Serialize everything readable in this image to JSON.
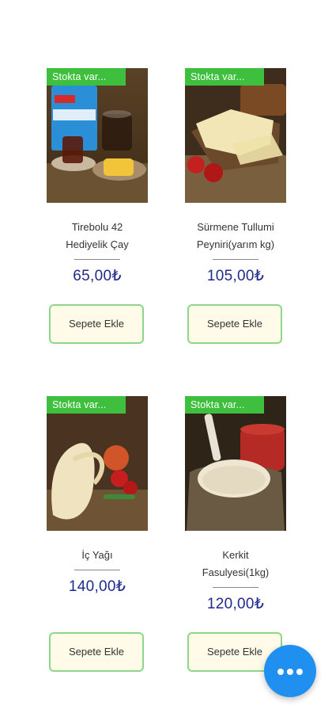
{
  "products": [
    {
      "badge": "Stokta var...",
      "title_line1": "Tirebolu 42",
      "title_line2": "Hediyelik Çay",
      "price": "65,00₺",
      "button": "Sepete Ekle"
    },
    {
      "badge": "Stokta var...",
      "title_line1": "Sürmene Tullumi",
      "title_line2": "Peyniri(yarım kg)",
      "price": "105,00₺",
      "button": "Sepete Ekle"
    },
    {
      "badge": "Stokta var...",
      "title_line1": "İç Yağı",
      "price": "140,00₺",
      "button": "Sepete Ekle"
    },
    {
      "badge": "Stokta var...",
      "title_line1": "Kerkit",
      "title_line2": "Fasulyesi(1kg)",
      "price": "120,00₺",
      "button": "Sepete Ekle"
    }
  ],
  "fab": {
    "icon": "more-horizontal-icon",
    "color": "#1f8ff0"
  },
  "colors": {
    "badge": "#3ec03e",
    "price": "#1f2a8c",
    "button_border": "#8ed68a",
    "button_bg": "#fffbe8"
  }
}
